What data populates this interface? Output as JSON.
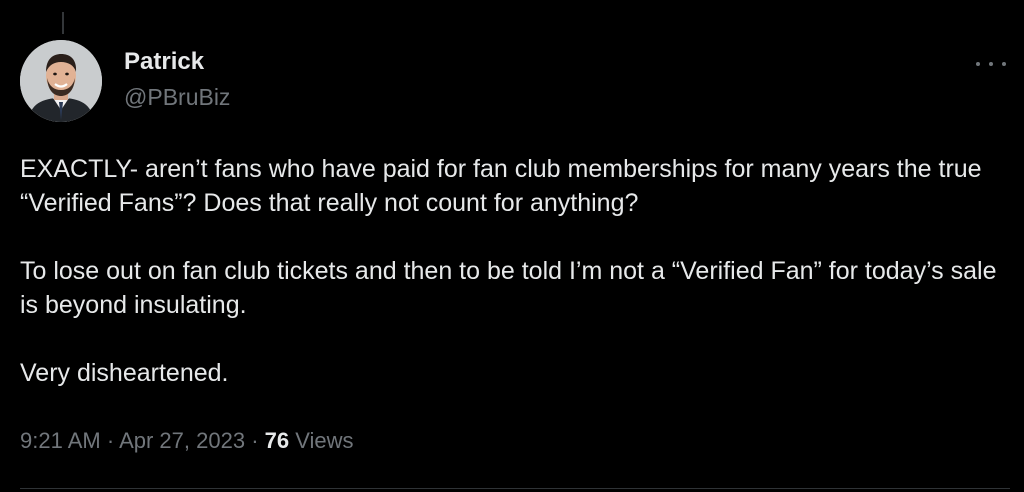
{
  "tweet": {
    "author": {
      "name": "Patrick",
      "handle": "@PBruBiz"
    },
    "paragraphs": [
      "EXACTLY- aren’t fans who have paid for fan club memberships for many years the true “Verified Fans”? Does that really not count for anything?",
      "To lose out on fan club tickets and then to be told I’m not a “Verified Fan” for today’s sale is beyond insulating.",
      "Very disheartened."
    ],
    "meta": {
      "time": "9:21 AM",
      "separator": "·",
      "date": "Apr 27, 2023",
      "views_count": "76",
      "views_label": "Views"
    }
  },
  "icons": {
    "more": "more-horizontal-icon",
    "avatar": "profile-photo"
  },
  "colors": {
    "background": "#000000",
    "text_primary": "#e7e9ea",
    "text_secondary": "#71767b",
    "divider": "#2f3336"
  }
}
